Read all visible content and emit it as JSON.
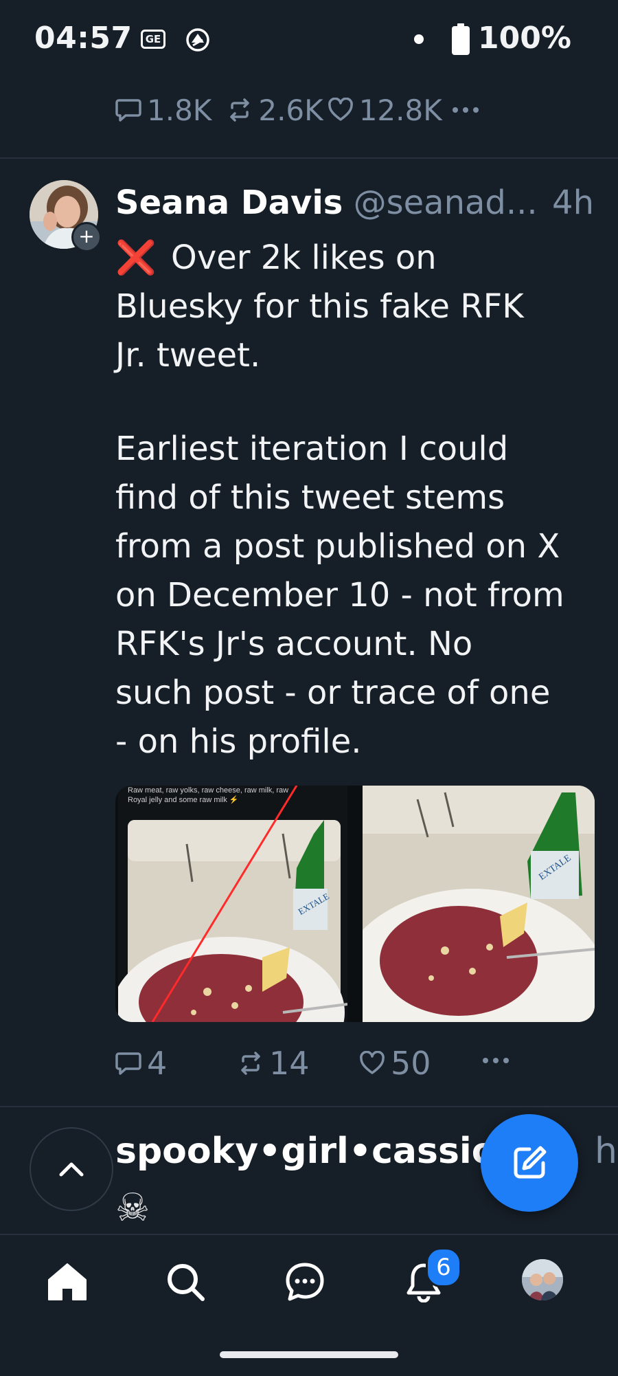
{
  "status_bar": {
    "time": "04:57",
    "ge_badge": "GE",
    "battery": "100%"
  },
  "previous_post": {
    "replies": "1.8K",
    "reposts": "2.6K",
    "likes": "12.8K"
  },
  "post": {
    "author_name": "Seana Davis",
    "author_handle": "@seanad...",
    "time": "4h",
    "x_mark": "❌",
    "line1": "Over 2k likes on",
    "line2": "Bluesky for this fake RFK",
    "line3": "Jr. tweet.",
    "para2_lines": [
      "Earliest iteration I could",
      "find of this tweet stems",
      "from a post published on X",
      "on December 10 - not from",
      "RFK's Jr's account. No",
      "such post - or trace of one",
      "- on his profile."
    ],
    "image_caption_line1": "Raw meat, raw yolks, raw cheese, raw milk, raw",
    "image_caption_line2": "Royal jelly and some raw milk ⚡",
    "replies": "4",
    "reposts": "14",
    "likes": "50"
  },
  "next_post": {
    "author_name": "spooky•girl•cassiop",
    "time": "h",
    "emoji": "☠"
  },
  "nav": {
    "notifications_badge": "6"
  },
  "colors": {
    "background": "#161e27",
    "muted_text": "#7f8fa3",
    "accent": "#1d7ef7",
    "x_mark": "#e8352c"
  },
  "icons": [
    "ge-icon",
    "app-notification-icon",
    "battery-icon",
    "reply-icon",
    "repost-icon",
    "like-icon",
    "more-icon",
    "plus-icon",
    "chevron-up-icon",
    "compose-icon",
    "home-icon",
    "search-icon",
    "chat-icon",
    "bell-icon"
  ]
}
